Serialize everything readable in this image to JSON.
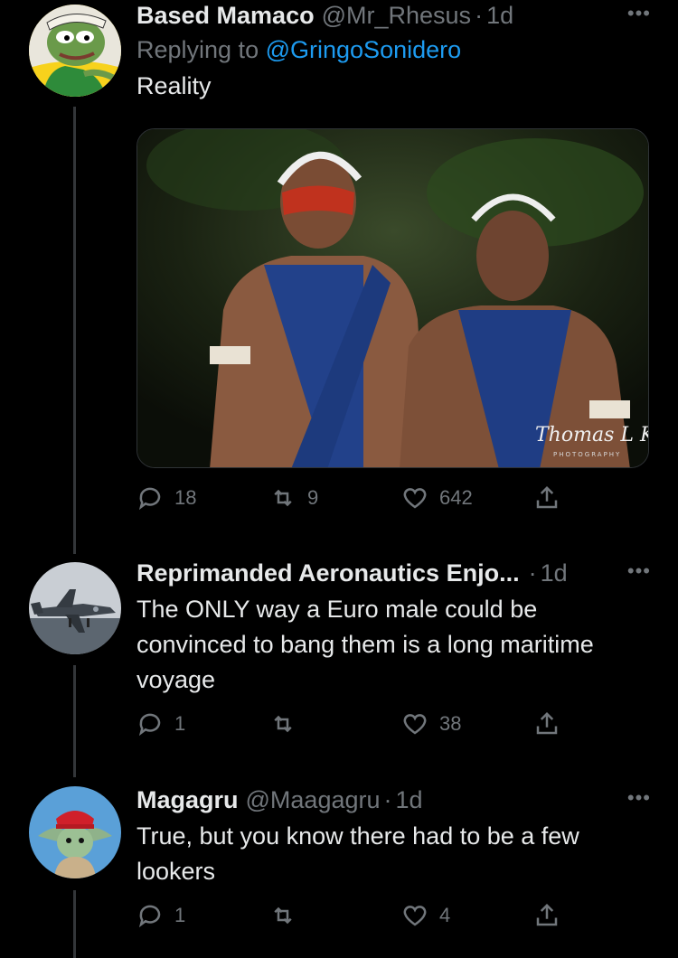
{
  "tweets": [
    {
      "name": "Based Mamaco",
      "handle": "@Mr_Rhesus",
      "time": "1d",
      "replying_prefix": "Replying to",
      "replying_to": "@GringoSonidero",
      "text": "Reality",
      "media_watermark": "Thomas L Kelly",
      "media_watermark_sub": "PHOTOGRAPHY",
      "replies": "18",
      "retweets": "9",
      "likes": "642"
    },
    {
      "name": "Reprimanded Aeronautics Enjo...",
      "handle": "",
      "time": "1d",
      "text": "The ONLY way a Euro male could be convinced to bang them is a long maritime voyage",
      "replies": "1",
      "retweets": "",
      "likes": "38"
    },
    {
      "name": "Magagru",
      "handle": "@Maagagru",
      "time": "1d",
      "text": "True, but you know there had to be a few lookers",
      "replies": "1",
      "retweets": "",
      "likes": "4"
    }
  ],
  "ui": {
    "separator": "·",
    "more": "•••"
  },
  "colors": {
    "background": "#000000",
    "text": "#e7e9ea",
    "muted": "#71767b",
    "link": "#1d9bf0"
  }
}
